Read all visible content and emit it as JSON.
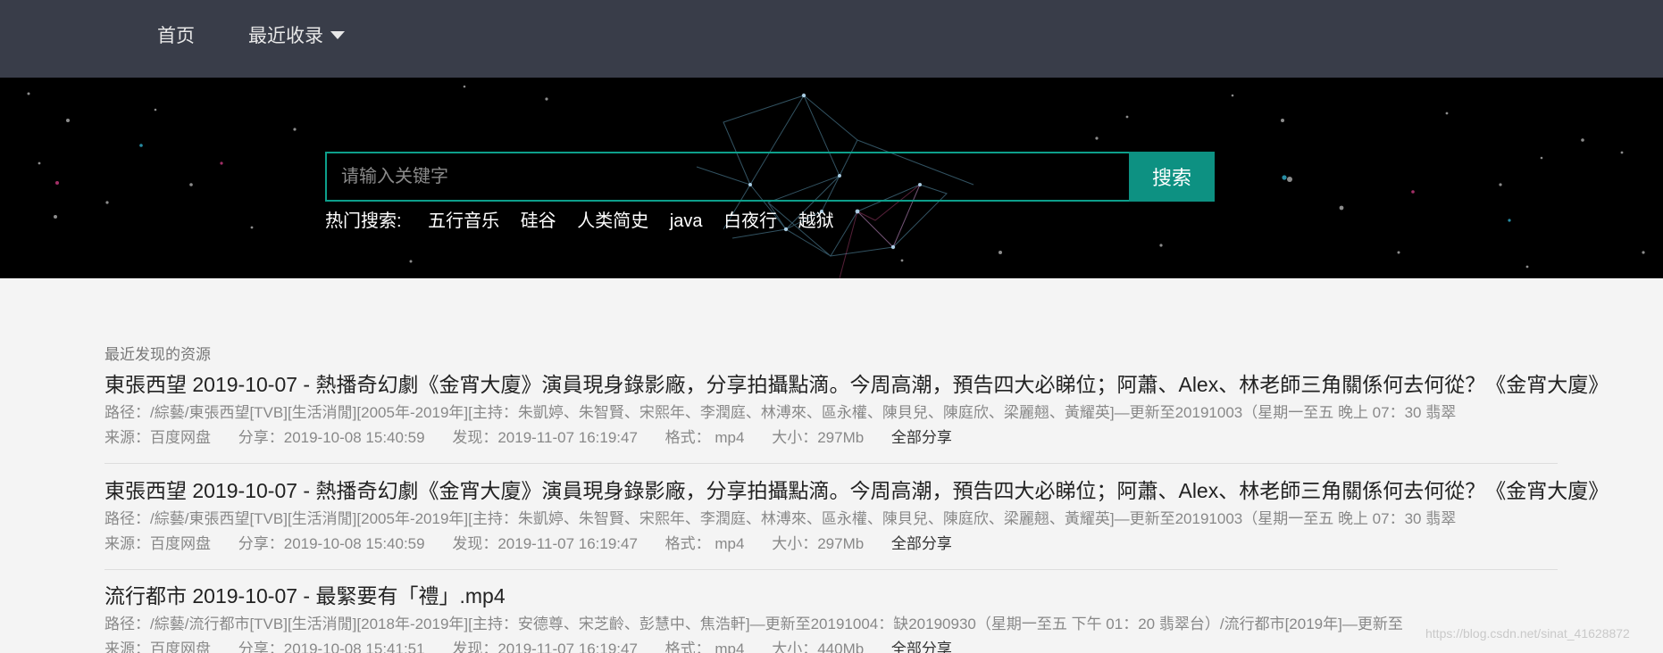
{
  "nav": {
    "home_label": "首页",
    "recent_label": "最近收录"
  },
  "search": {
    "placeholder": "请输入关键字",
    "button_label": "搜索",
    "hot_label": "热门搜索:",
    "hot_items": [
      "五行音乐",
      "硅谷",
      "人类简史",
      "java",
      "白夜行",
      "越狱"
    ]
  },
  "results_section": {
    "title": "最近发现的资源",
    "items": [
      {
        "title": "東張西望 2019-10-07 - 熱播奇幻劇《金宵大廈》演員現身錄影廠，分享拍攝點滴。今周高潮，預告四大必睇位；阿蕭、Alex、林老師三角關係何去何從？《金宵大廈》",
        "path": "路径：/綜藝/東張西望[TVB][生活消閒][2005年-2019年][主持：朱凱婷、朱智賢、宋熙年、李潤庭、林溥來、區永權、陳貝兒、陳庭欣、梁麗翹、黃耀英]—更新至20191003（星期一至五 晚上 07：30 翡翠",
        "source": "来源：百度网盘",
        "shared": "分享：2019-10-08 15:40:59",
        "found": "发现：2019-11-07 16:19:47",
        "format": "格式： mp4",
        "size": "大小：297Mb",
        "share_all": "全部分享"
      },
      {
        "title": "東張西望 2019-10-07 - 熱播奇幻劇《金宵大廈》演員現身錄影廠，分享拍攝點滴。今周高潮，預告四大必睇位；阿蕭、Alex、林老師三角關係何去何從？《金宵大廈》",
        "path": "路径：/綜藝/東張西望[TVB][生活消閒][2005年-2019年][主持：朱凱婷、朱智賢、宋熙年、李潤庭、林溥來、區永權、陳貝兒、陳庭欣、梁麗翹、黃耀英]—更新至20191003（星期一至五 晚上 07：30 翡翠",
        "source": "来源：百度网盘",
        "shared": "分享：2019-10-08 15:40:59",
        "found": "发现：2019-11-07 16:19:47",
        "format": "格式： mp4",
        "size": "大小：297Mb",
        "share_all": "全部分享"
      },
      {
        "title": "流行都市 2019-10-07 - 最緊要有「禮」.mp4",
        "path": "路径：/綜藝/流行都市[TVB][生活消閒][2018年-2019年][主持：安德尊、宋芝齡、彭慧中、焦浩軒]—更新至20191004：缺20190930（星期一至五 下午 01：20 翡翠台）/流行都市[2019年]—更新至",
        "source": "来源：百度网盘",
        "shared": "分享：2019-10-08 15:41:51",
        "found": "发现：2019-11-07 16:19:47",
        "format": "格式： mp4",
        "size": "大小：440Mb",
        "share_all": "全部分享"
      }
    ]
  },
  "watermark": "https://blog.csdn.net/sinat_41628872",
  "colors": {
    "nav_bg": "#393d49",
    "accent": "#0d9182",
    "hero_bg": "#000000",
    "page_bg": "#f4f4f4"
  }
}
